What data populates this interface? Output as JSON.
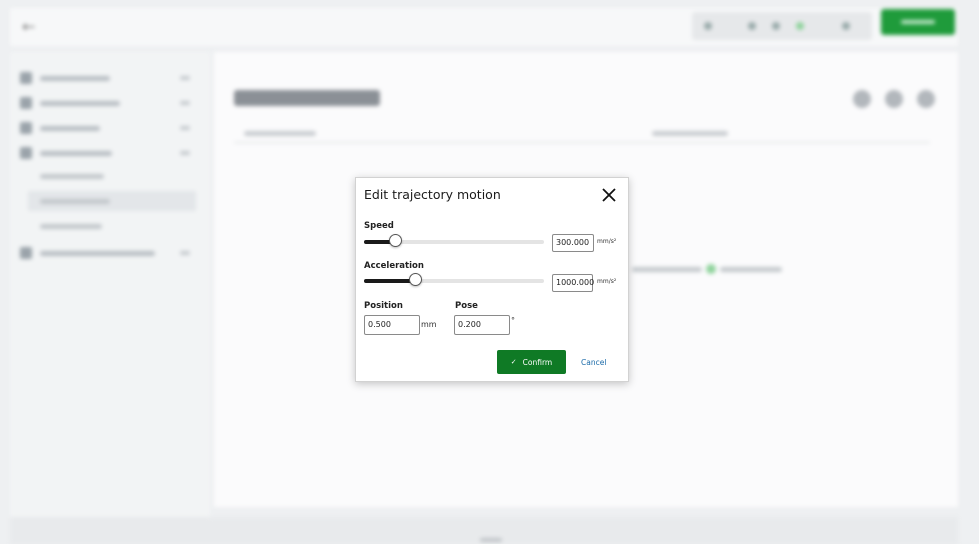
{
  "dialog": {
    "title": "Edit trajectory motion",
    "speed": {
      "label": "Speed",
      "value": "300.000",
      "unit": "mm/s²",
      "slider_fraction": 0.18
    },
    "acceleration": {
      "label": "Acceleration",
      "value": "1000.000",
      "unit": "mm/s²",
      "slider_fraction": 0.29
    },
    "position": {
      "label": "Position",
      "value": "0.500",
      "unit": "mm"
    },
    "pose": {
      "label": "Pose",
      "value": "0.200",
      "unit": "°"
    },
    "confirm_label": "Confirm",
    "cancel_label": "Cancel"
  },
  "icons": {
    "close": "close-icon",
    "confirm": "check-icon",
    "back": "back-arrow-icon"
  },
  "colors": {
    "confirm_bg": "#0f7a25",
    "cancel_text": "#1a6aa8",
    "top_action": "#1f9b3b"
  }
}
